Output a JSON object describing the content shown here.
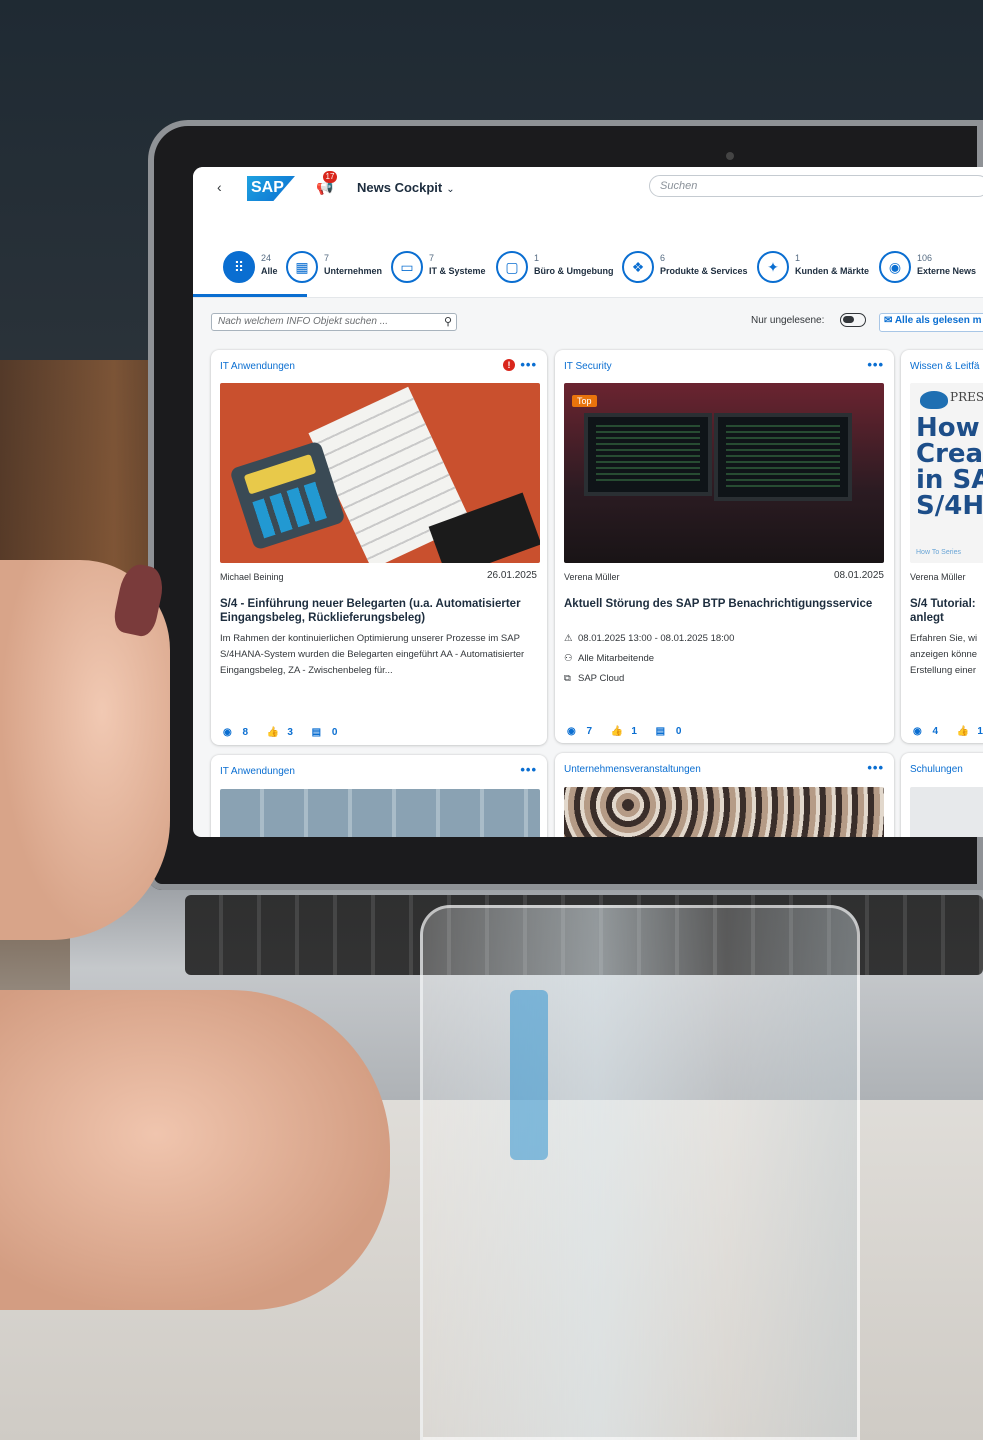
{
  "header": {
    "app_title": "News Cockpit",
    "notification_count": "17",
    "search_placeholder": "Suchen"
  },
  "categories": [
    {
      "count": "24",
      "label": "Alle",
      "icon": "grid-icon",
      "glyph": "⠿"
    },
    {
      "count": "7",
      "label": "Unternehmen",
      "icon": "building-icon",
      "glyph": "▦"
    },
    {
      "count": "7",
      "label": "IT & Systeme",
      "icon": "monitor-icon",
      "glyph": "▭"
    },
    {
      "count": "1",
      "label": "Büro & Umgebung",
      "icon": "frame-icon",
      "glyph": "▢"
    },
    {
      "count": "6",
      "label": "Produkte & Services",
      "icon": "product-icon",
      "glyph": "❖"
    },
    {
      "count": "1",
      "label": "Kunden & Märkte",
      "icon": "handshake-icon",
      "glyph": "✦"
    },
    {
      "count": "106",
      "label": "Externe News",
      "icon": "globe-icon",
      "glyph": "◉"
    }
  ],
  "toolbar": {
    "object_search_placeholder": "Nach welchem INFO Objekt suchen ...",
    "unread_label": "Nur ungelesene:",
    "mark_all_label": "Alle als gelesen m"
  },
  "cards": [
    {
      "category": "IT Anwendungen",
      "author": "Michael Beining",
      "date": "26.01.2025",
      "title": "S/4 - Einführung neuer Belegarten (u.a. Automatisierter Eingangsbeleg, Rücklieferungsbeleg)",
      "body": "Im Rahmen der kontinuierlichen Optimierung unserer Prozesse im SAP S/4HANA-System wurden die Belegarten eingeführt AA - Automatisierter Eingangsbeleg, ZA - Zwischenbeleg für...",
      "views": "8",
      "likes": "3",
      "comments": "0"
    },
    {
      "category": "IT Security",
      "tag": "Top",
      "author": "Verena Müller",
      "date": "08.01.2025",
      "title": "Aktuell Störung des SAP BTP Benachrichtigungsservice",
      "time_range": "08.01.2025 13:00 - 08.01.2025 18:00",
      "audience": "Alle Mitarbeitende",
      "system": "SAP Cloud",
      "views": "7",
      "likes": "1",
      "comments": "0"
    },
    {
      "category": "Wissen & Leitfä",
      "author": "Verena Müller",
      "book_brand": "PRESS",
      "book_title": "How\nCreat\nin SA\nS/4H.",
      "book_series": "How To Series",
      "title": "S/4 Tutorial: anlegt",
      "body": "Erfahren Sie, wi anzeigen könne Erstellung einer",
      "views": "4",
      "likes": "1"
    },
    {
      "category": "IT Anwendungen"
    },
    {
      "category": "Unternehmensveranstaltungen"
    },
    {
      "category": "Schulungen"
    }
  ]
}
